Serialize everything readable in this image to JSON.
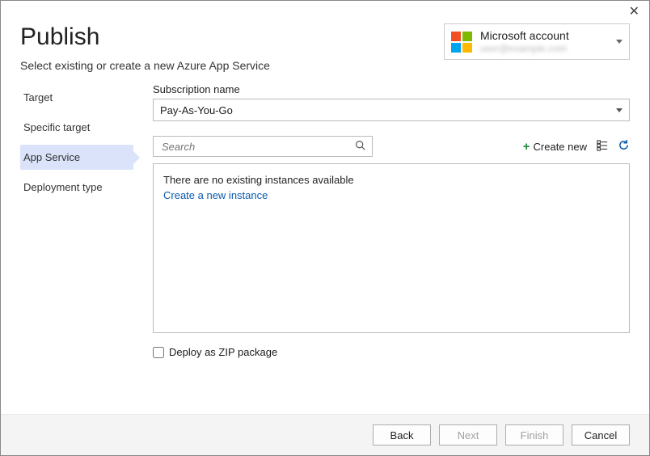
{
  "window": {
    "close": "✕"
  },
  "header": {
    "title": "Publish",
    "subtitle": "Select existing or create a new Azure App Service"
  },
  "account": {
    "name": "Microsoft account",
    "email": "user@example.com"
  },
  "steps": {
    "items": [
      {
        "label": "Target"
      },
      {
        "label": "Specific target"
      },
      {
        "label": "App Service"
      },
      {
        "label": "Deployment type"
      }
    ],
    "activeIndex": 2
  },
  "subscription": {
    "label": "Subscription name",
    "value": "Pay-As-You-Go"
  },
  "search": {
    "placeholder": "Search"
  },
  "toolbar": {
    "create_new": "Create new"
  },
  "list": {
    "empty_text": "There are no existing instances available",
    "create_link": "Create a new instance"
  },
  "deploy_zip": {
    "label": "Deploy as ZIP package",
    "checked": false
  },
  "footer": {
    "back": "Back",
    "next": "Next",
    "finish": "Finish",
    "cancel": "Cancel"
  }
}
